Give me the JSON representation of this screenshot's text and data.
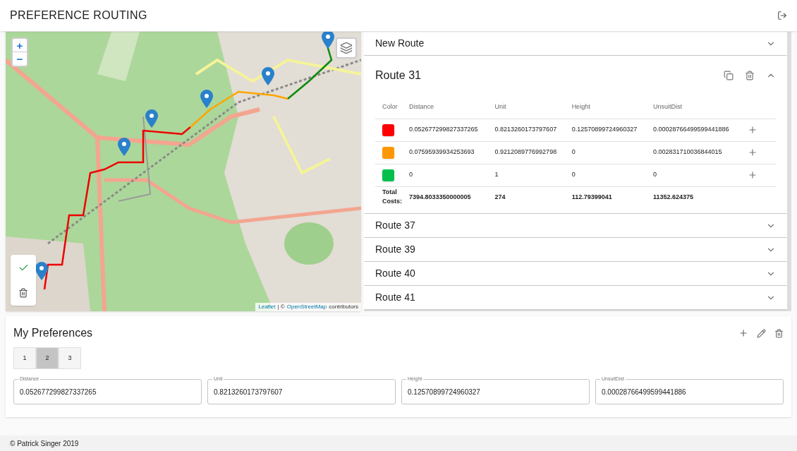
{
  "header": {
    "title": "PREFERENCE ROUTING"
  },
  "map": {
    "zoom_in": "+",
    "zoom_out": "−",
    "attribution": {
      "link1": "Leaflet",
      "separator": "| ©",
      "link2": "OpenStreetMap",
      "suffix": "contributors"
    }
  },
  "routes": [
    {
      "name": "New Route",
      "expanded": false
    },
    {
      "name": "Route 31",
      "expanded": true,
      "table": {
        "columns": [
          "Color",
          "Distance",
          "Unit",
          "Height",
          "UnsuitDist"
        ],
        "rows": [
          {
            "color": "#ff0000",
            "values": [
              "0.052677299827337265",
              "0.8213260173797607",
              "0.12570899724960327",
              "0.00028766499599441886"
            ]
          },
          {
            "color": "#ff9800",
            "values": [
              "0.07595939934253693",
              "0.9212089776992798",
              "0",
              "0.002831710036844015"
            ]
          },
          {
            "color": "#00c04b",
            "values": [
              "0",
              "1",
              "0",
              "0"
            ]
          }
        ],
        "total": {
          "label": "Total Costs:",
          "values": [
            "7394.8033350000005",
            "274",
            "112.79399041",
            "11352.624375"
          ]
        }
      }
    },
    {
      "name": "Route 37",
      "expanded": false
    },
    {
      "name": "Route 39",
      "expanded": false
    },
    {
      "name": "Route 40",
      "expanded": false
    },
    {
      "name": "Route 41",
      "expanded": false
    }
  ],
  "preferences": {
    "title": "My Preferences",
    "tabs": [
      {
        "label": "1",
        "selected": false
      },
      {
        "label": "2",
        "selected": true
      },
      {
        "label": "3",
        "selected": false
      }
    ],
    "fields": [
      {
        "label": "Distance",
        "value": "0.052677299827337265"
      },
      {
        "label": "Unit",
        "value": "0.8213260173797607"
      },
      {
        "label": "Height",
        "value": "0.12570899724960327"
      },
      {
        "label": "UnsuitDist",
        "value": "0.00028766499599441886"
      }
    ]
  },
  "footer": {
    "text": "© Patrick Singer 2019"
  }
}
